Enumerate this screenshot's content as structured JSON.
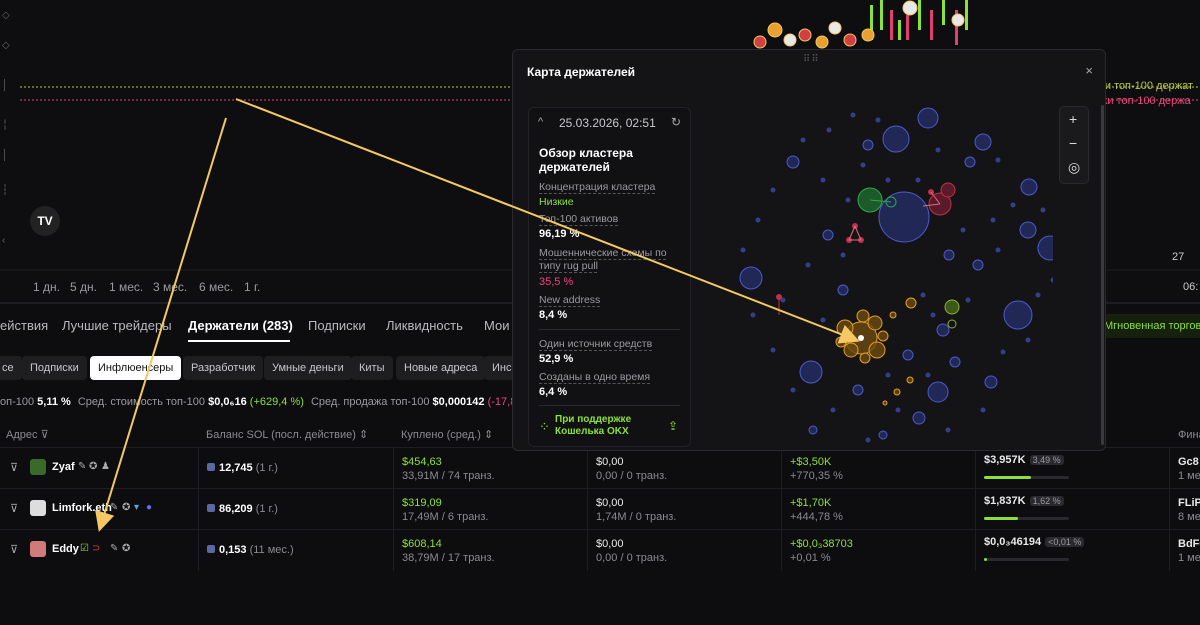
{
  "chart": {
    "legend_top100_buy": "ки топ-100 держат",
    "legend_top100_sell": "жи топ-100 держа",
    "date_tick": "27",
    "time_tick": "06:",
    "tv_logo": "TV",
    "ranges": [
      "1 дн.",
      "5 дн.",
      "1 мес.",
      "3 мес.",
      "6 мес.",
      "1 г."
    ]
  },
  "tabs": [
    "ействия",
    "Лучшие трейдеры",
    "Держатели (283)",
    "Подписки",
    "Ликвидность",
    "Мои"
  ],
  "instant_trade": "Мгновенная торгов",
  "chips": [
    "се",
    "Подписки",
    "Инфлюенсеры",
    "Разработчик",
    "Умные деньги",
    "Киты",
    "Новые адреса",
    "Инса"
  ],
  "stats": {
    "top100_label": "оп-100",
    "top100_value": "5,11 %",
    "avg_cost_label": "Сред. стоимость топ-100",
    "avg_cost_value": "$0,0₆16",
    "avg_cost_change": "(+629,4 %)",
    "avg_sell_label": "Сред. продажа топ-100",
    "avg_sell_value": "$0,000142",
    "avg_sell_change": "(-17,81 %"
  },
  "table": {
    "headers": {
      "address": "Адрес",
      "balance": "Баланс SOL (посл. действие)",
      "bought": "Куплено (сред.)",
      "fin": "Фина"
    },
    "rows": [
      {
        "name": "Zyaf",
        "balance": "12,745",
        "balance_age": "(1 г.)",
        "bought": "$454,63",
        "bought_sub": "33,91M / 74 транз.",
        "sold": "$0,00",
        "sold_sub": "0,00 / 0 транз.",
        "pnl": "+$3,50K",
        "pnl_pct": "+770,35 %",
        "holding": "$3,957K",
        "holding_pct": "3,49 %",
        "holding_fill": 0.55,
        "fin": "Gc8",
        "fin_sub": "1 ме"
      },
      {
        "name": "Limfork.eth",
        "balance": "86,209",
        "balance_age": "(1 г.)",
        "bought": "$319,09",
        "bought_sub": "17,49M / 6 транз.",
        "sold": "$0,00",
        "sold_sub": "1,74M / 0 транз.",
        "pnl": "+$1,70K",
        "pnl_pct": "+444,78 %",
        "holding": "$1,837K",
        "holding_pct": "1,62 %",
        "holding_fill": 0.4,
        "fin": "FLiP",
        "fin_sub": "8 ме"
      },
      {
        "name": "Eddy",
        "balance": "0,153",
        "balance_age": "(11 мес.)",
        "bought": "$608,14",
        "bought_sub": "38,79M / 17 транз.",
        "sold": "$0,00",
        "sold_sub": "0,00 / 0 транз.",
        "pnl": "+$0,0₃38703",
        "pnl_pct": "+0,01 %",
        "holding": "$0,0₃46194",
        "holding_pct": "<0,01 %",
        "holding_fill": 0.03,
        "fin": "BdF6",
        "fin_sub": "1 ме"
      }
    ]
  },
  "modal": {
    "title": "Карта держателей",
    "close": "×",
    "timestamp": "25.03.2026, 02:51",
    "overview_title": "Обзор кластера держателей",
    "concentration_label": "Концентрация кластера",
    "concentration_value": "Низкие",
    "top100_label": "Топ-100 активов",
    "top100_value": "96,19 %",
    "fraud_label": "Мошеннические схемы по типу rug pull",
    "fraud_value": "35,5 %",
    "new_address_label": "New address",
    "new_address_value": "8,4 %",
    "one_source_label": "Один источник средств",
    "one_source_value": "52,9 %",
    "same_time_label": "Созданы в одно время",
    "same_time_value": "6,4 %",
    "powered_by": "При поддержке Кошелька OKX",
    "zoom_in": "+",
    "zoom_out": "−",
    "recenter": "◎"
  },
  "colors": {
    "accent_green": "#8ce03c",
    "accent_red": "#f0457a",
    "arrow_yellow": "#f4c863",
    "bubble_blue": "#3c4aa8",
    "bubble_orange": "#e6a020",
    "bubble_green": "#2ea84a",
    "bubble_red": "#c0304a"
  }
}
